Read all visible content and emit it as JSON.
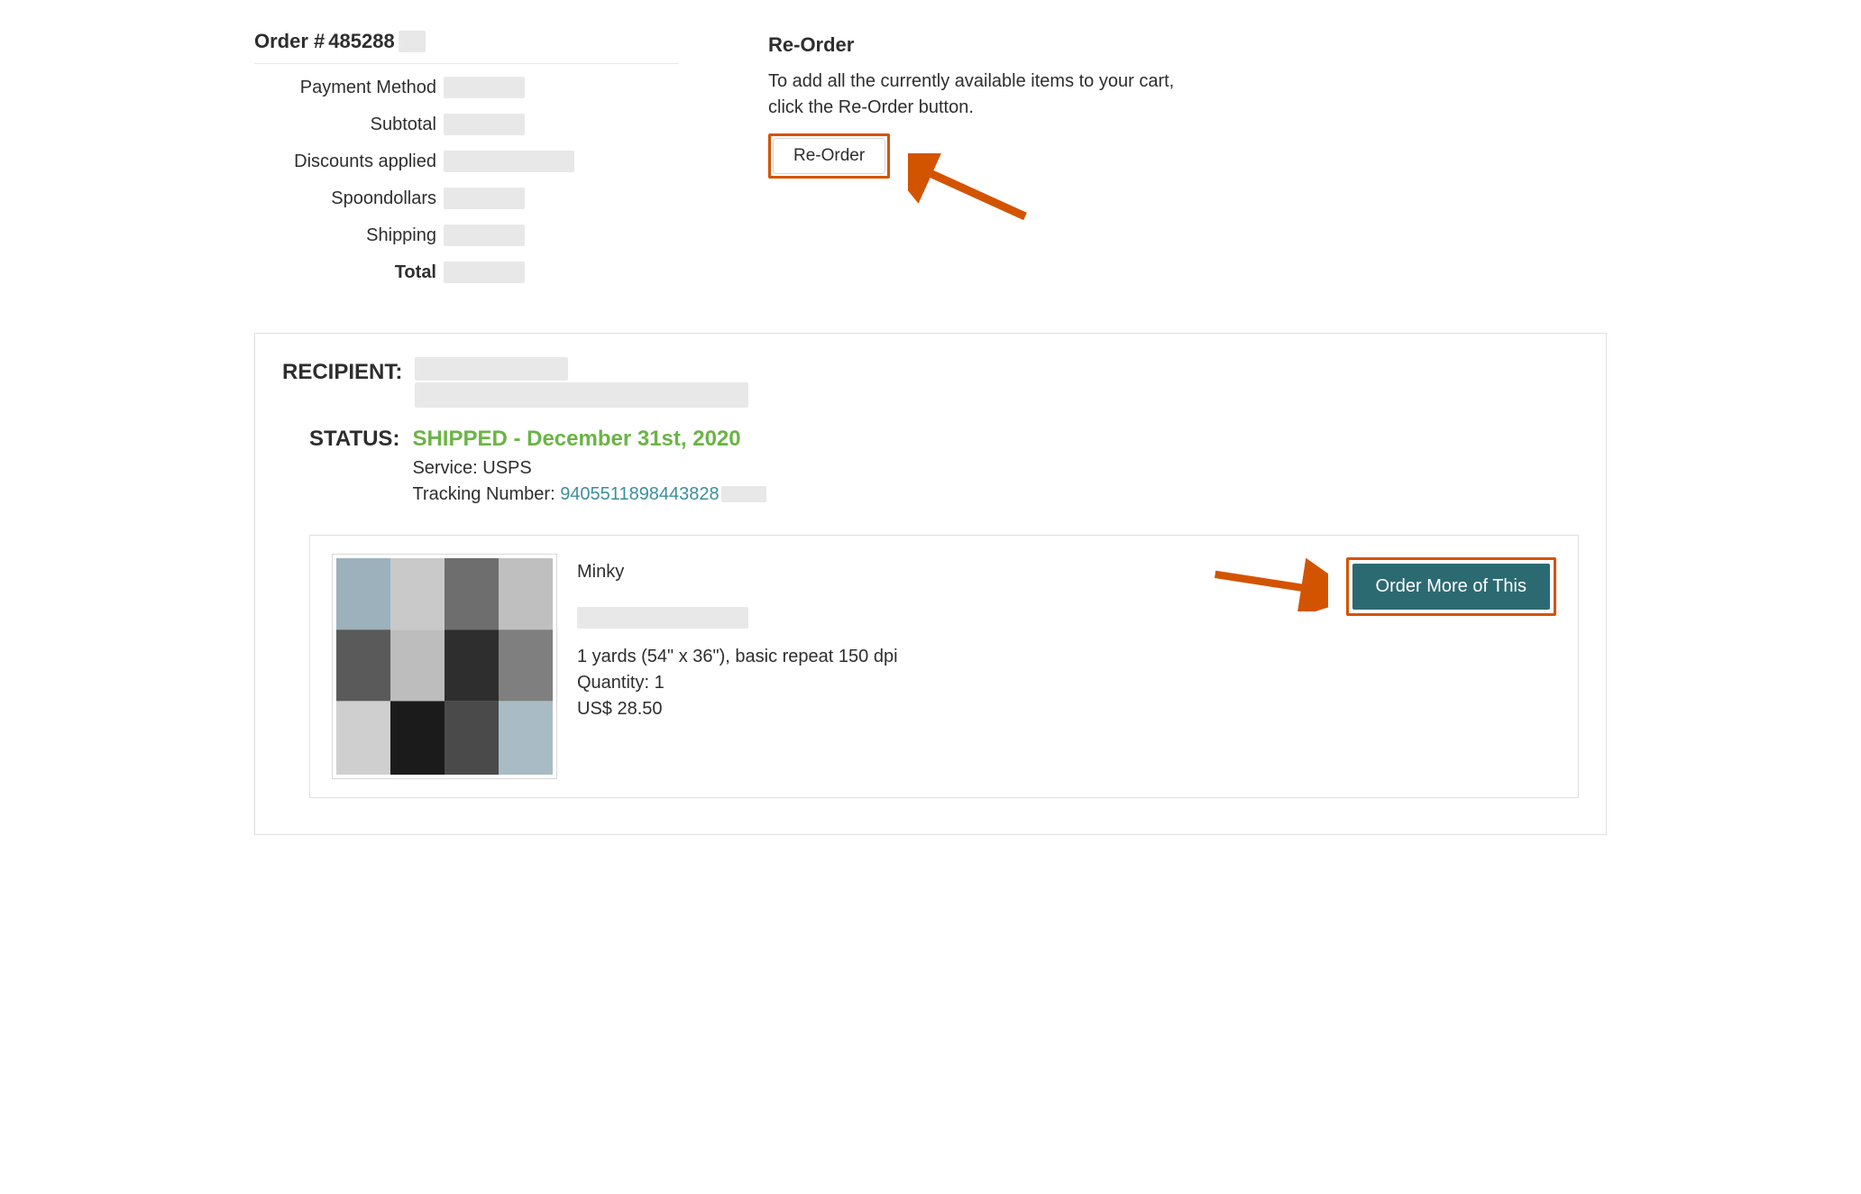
{
  "order": {
    "header_prefix": "Order #",
    "number": "485288",
    "rows": {
      "payment_method": "Payment Method",
      "subtotal": "Subtotal",
      "discounts": "Discounts applied",
      "spoondollars": "Spoondollars",
      "shipping": "Shipping",
      "total": "Total"
    }
  },
  "reorder": {
    "title": "Re-Order",
    "description_line1": "To add all the currently available items to your cart,",
    "description_line2": "click the Re-Order button.",
    "button": "Re-Order"
  },
  "shipment": {
    "recipient_label": "RECIPIENT:",
    "status_label": "STATUS:",
    "status_text": "SHIPPED - December 31st, 2020",
    "service_prefix": "Service: ",
    "service_value": "USPS",
    "tracking_prefix": "Tracking Number: ",
    "tracking_number": "9405511898443828"
  },
  "item": {
    "title": "Minky",
    "spec": "1 yards (54\" x 36\"), basic repeat 150 dpi",
    "quantity_line": "Quantity: 1",
    "price": "US$ 28.50",
    "order_more_button": "Order More of This"
  },
  "colors": {
    "highlight": "#d35400",
    "teal": "#2c6a72",
    "green": "#6bb446",
    "link": "#3d8e9e"
  }
}
